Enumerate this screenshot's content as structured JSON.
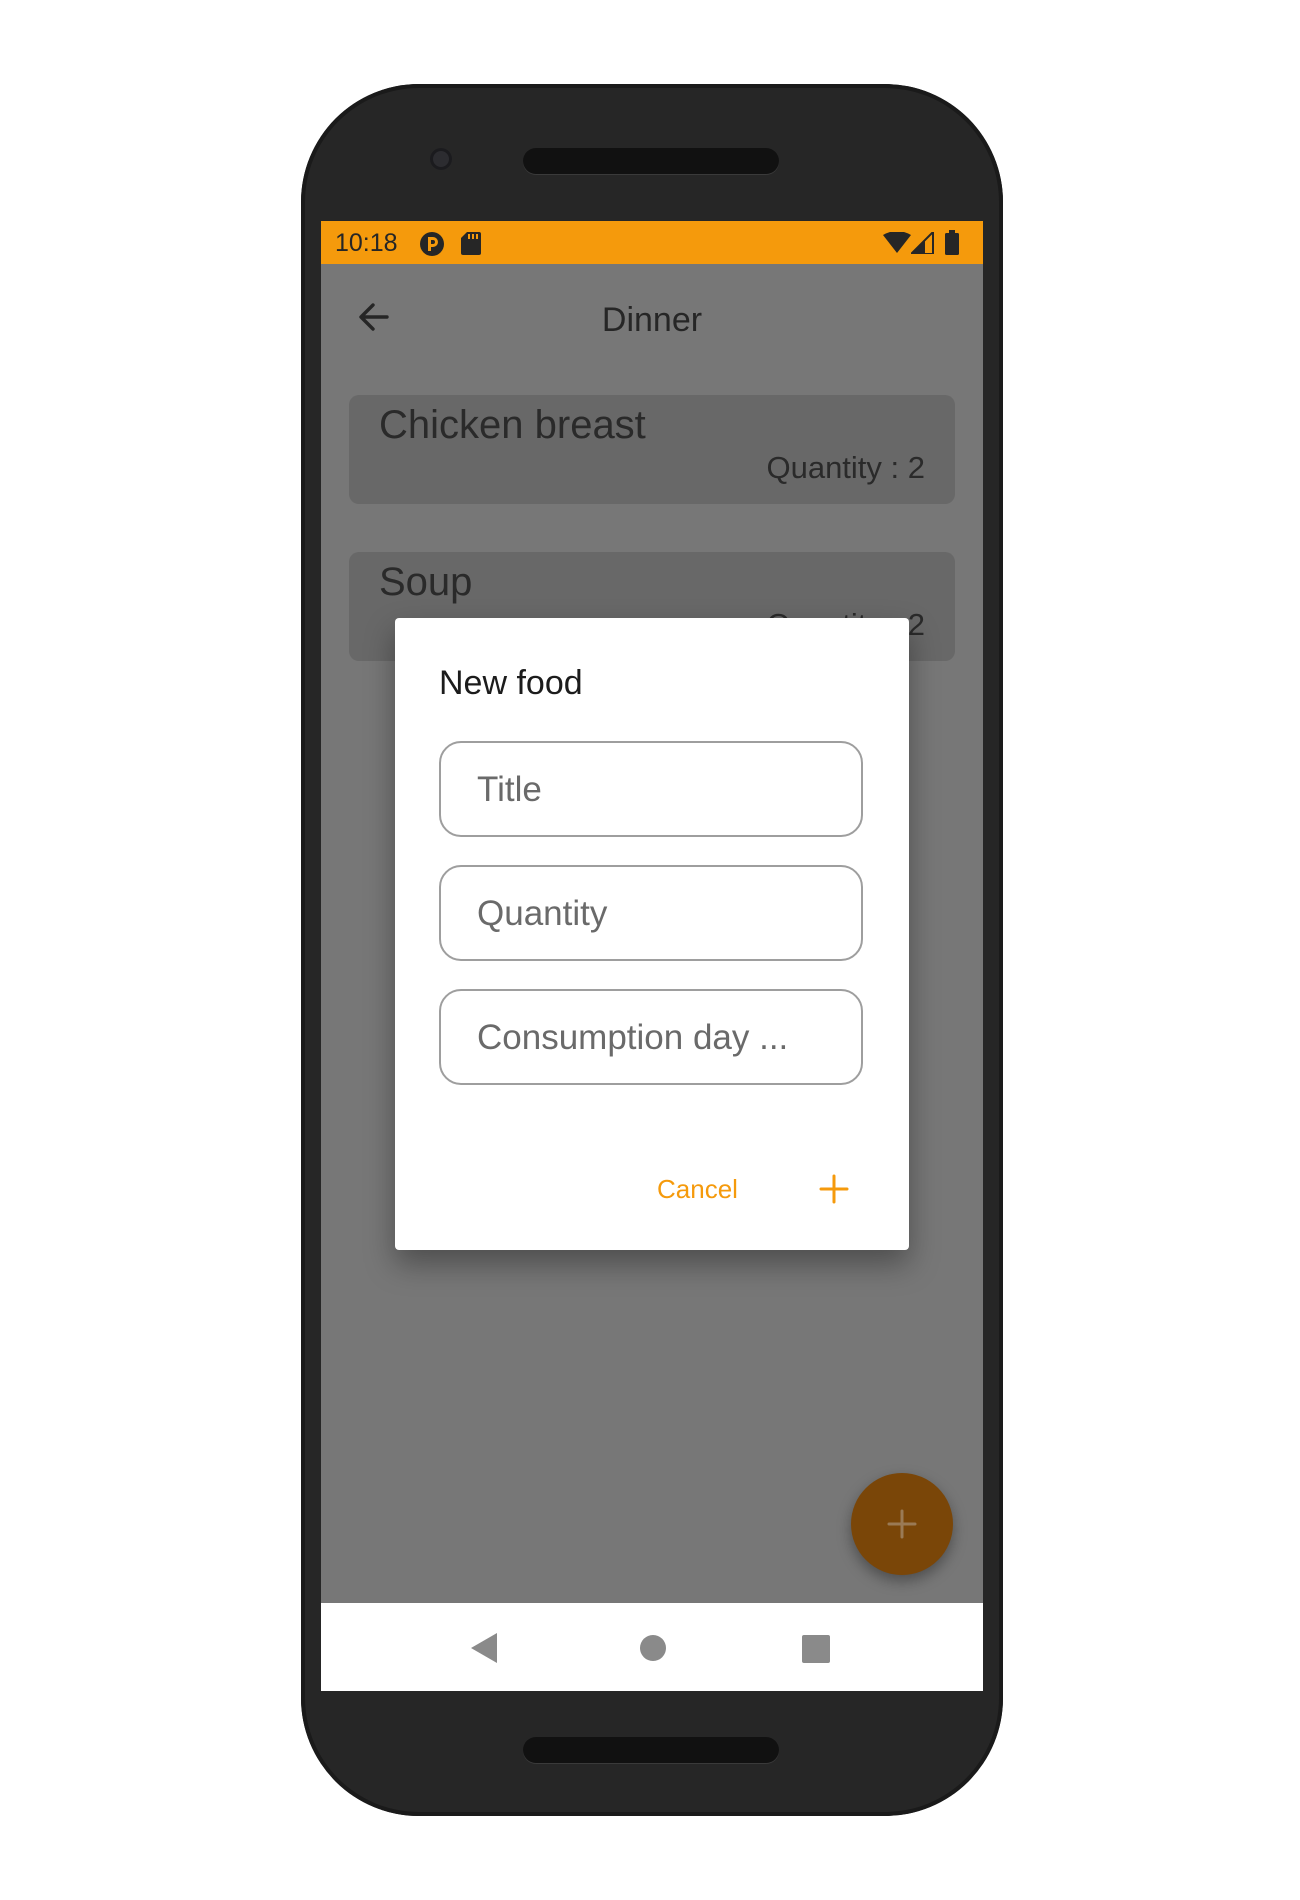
{
  "status_bar": {
    "time": "10:18",
    "left_icons": [
      "app-notification-icon",
      "sd-card-icon"
    ],
    "right_icons": [
      "wifi-icon",
      "cell-signal-icon",
      "battery-icon"
    ],
    "color": "#f59a0c"
  },
  "app_bar": {
    "title": "Dinner",
    "back_icon": "arrow-left-icon"
  },
  "food_list": [
    {
      "name": "Chicken breast",
      "quantity": "Quantity : 2"
    },
    {
      "name": "Soup",
      "quantity": "Quantity : 2"
    }
  ],
  "dialog": {
    "title": "New food",
    "fields": [
      {
        "placeholder": "Title",
        "value": ""
      },
      {
        "placeholder": "Quantity",
        "value": ""
      },
      {
        "placeholder": "Consumption day ...",
        "value": ""
      }
    ],
    "cancel_label": "Cancel",
    "confirm_icon": "plus-icon"
  },
  "fab": {
    "icon": "plus-icon"
  },
  "nav_bar": {
    "icons": [
      "back-triangle-icon",
      "home-circle-icon",
      "recents-square-icon"
    ]
  },
  "colors": {
    "accent": "#f59a0c",
    "scrim": "#777777",
    "card": "#686868"
  }
}
